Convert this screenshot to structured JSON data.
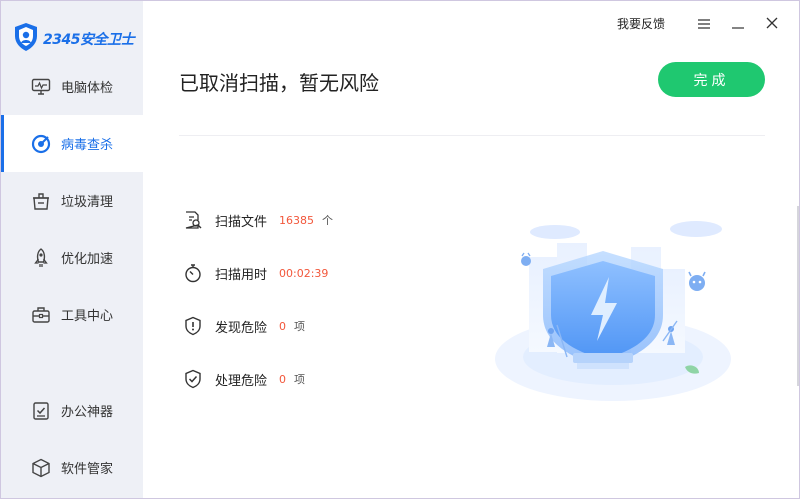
{
  "app": {
    "logo_text": "2345安全卫士"
  },
  "titlebar": {
    "feedback_label": "我要反馈"
  },
  "sidebar": {
    "items": [
      {
        "label": "电脑体检"
      },
      {
        "label": "病毒查杀"
      },
      {
        "label": "垃圾清理"
      },
      {
        "label": "优化加速"
      },
      {
        "label": "工具中心"
      },
      {
        "label": "办公神器"
      },
      {
        "label": "软件管家"
      }
    ]
  },
  "main": {
    "title": "已取消扫描，暂无风险",
    "done_label": "完成",
    "stats": [
      {
        "label": "扫描文件",
        "value": "16385",
        "unit": "个"
      },
      {
        "label": "扫描用时",
        "value": "00:02:39",
        "unit": ""
      },
      {
        "label": "发现危险",
        "value": "0",
        "unit": "项"
      },
      {
        "label": "处理危险",
        "value": "0",
        "unit": "项"
      }
    ]
  },
  "colors": {
    "accent": "#1a6fe8",
    "done_button": "#1fc870",
    "value_text": "#f2573b",
    "sidebar_bg": "#eef0f6"
  }
}
